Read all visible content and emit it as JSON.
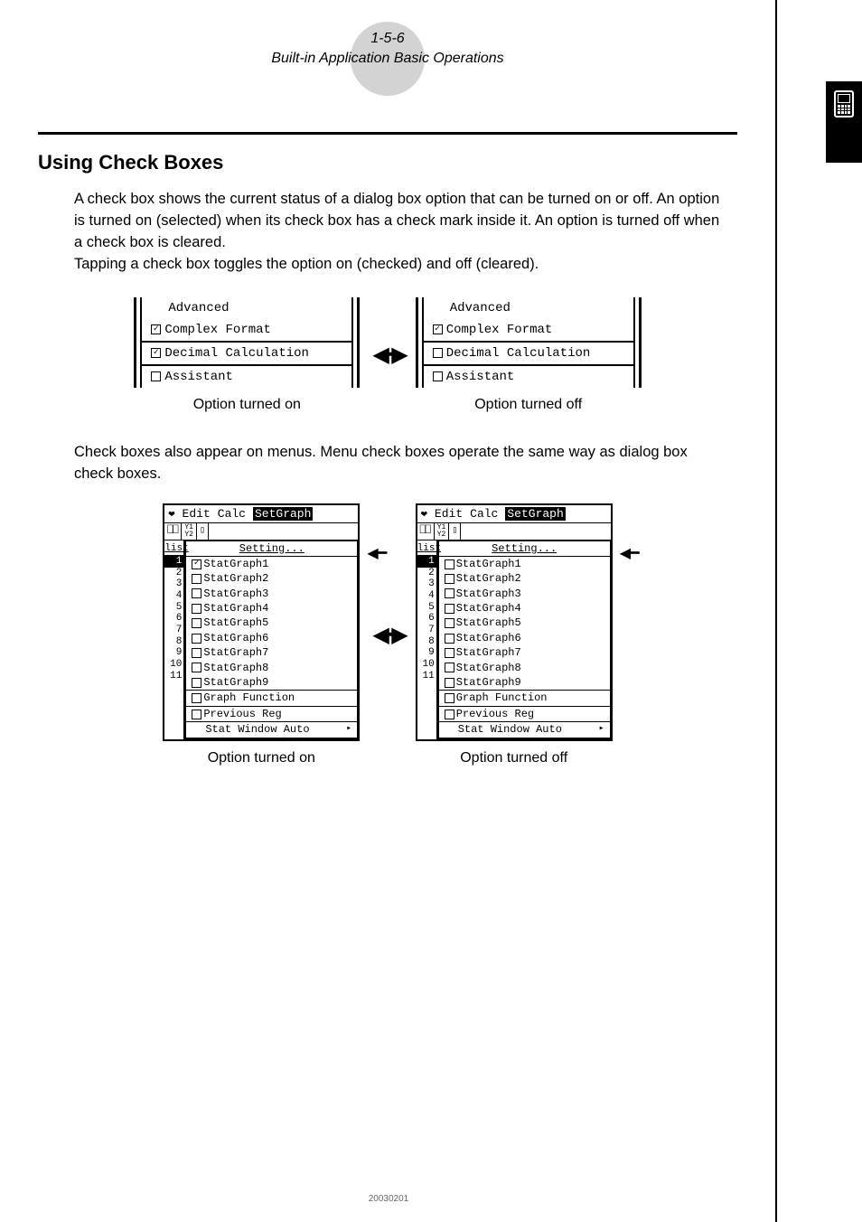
{
  "header": {
    "page_ref": "1-5-6",
    "chapter": "Built-in Application Basic Operations"
  },
  "section_title": "Using Check Boxes",
  "para1": "A check box shows the current status of a dialog box option that can be turned on or off. An option is turned on (selected) when its check box has a check mark inside it. An option is turned off when a check box is cleared.",
  "para2": "Tapping a check box toggles the option on (checked) and off (cleared).",
  "dialog": {
    "items": {
      "advanced": "Advanced",
      "complex": "Complex Format",
      "decimal": "Decimal Calculation",
      "assistant": "Assistant"
    }
  },
  "caption_on": "Option turned on",
  "caption_off": "Option turned off",
  "para3": "Check boxes also appear on menus. Menu check boxes operate the same way as dialog box check boxes.",
  "menu": {
    "menubar": {
      "edit": "Edit",
      "calc": "Calc",
      "setgraph": "SetGraph"
    },
    "toolbar": {
      "list": "list"
    },
    "items": {
      "setting": "Setting...",
      "sg1": "StatGraph1",
      "sg2": "StatGraph2",
      "sg3": "StatGraph3",
      "sg4": "StatGraph4",
      "sg5": "StatGraph5",
      "sg6": "StatGraph6",
      "sg7": "StatGraph7",
      "sg8": "StatGraph8",
      "sg9": "StatGraph9",
      "graphfn": "Graph Function",
      "prevreg": "Previous Reg",
      "statwin": "Stat Window Auto"
    },
    "rownums": [
      "1",
      "2",
      "3",
      "4",
      "5",
      "6",
      "7",
      "8",
      "9",
      "10",
      "11"
    ]
  },
  "footer": "20030201"
}
